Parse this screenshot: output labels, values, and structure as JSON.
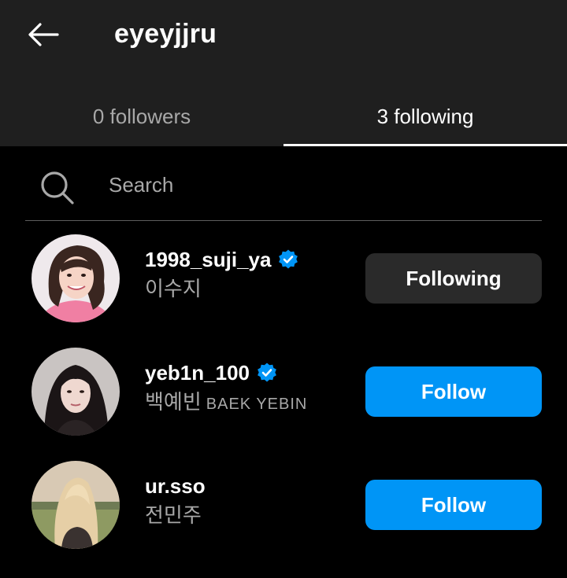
{
  "header": {
    "title": "eyeyjjru",
    "back_icon": "arrow-left-icon"
  },
  "tabs": [
    {
      "label": "0 followers",
      "active": false
    },
    {
      "label": "3 following",
      "active": true
    }
  ],
  "search": {
    "placeholder": "Search",
    "value": "",
    "icon": "search-icon"
  },
  "accounts": [
    {
      "username": "1998_suji_ya",
      "verified": true,
      "display_name": "이수지",
      "display_name_latin": "",
      "button_label": "Following",
      "button_state": "following"
    },
    {
      "username": "yeb1n_100",
      "verified": true,
      "display_name": "백예빈",
      "display_name_latin": "BAEK YEBIN",
      "button_label": "Follow",
      "button_state": "follow"
    },
    {
      "username": "ur.sso",
      "verified": false,
      "display_name": "전민주",
      "display_name_latin": "",
      "button_label": "Follow",
      "button_state": "follow"
    }
  ],
  "colors": {
    "background": "#000000",
    "header_bg": "#1f1f1f",
    "follow_button": "#0095f6",
    "following_button": "#2a2a2a",
    "verified_badge": "#0095f6",
    "secondary_text": "#a8a8a8"
  }
}
